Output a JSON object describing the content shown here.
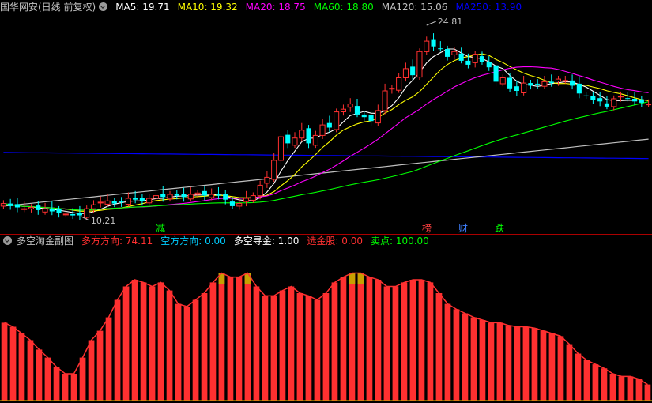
{
  "main_panel": {
    "title": "国华网安(日线 前复权)",
    "indicators": [
      {
        "label": "MA5: 19.71",
        "color": "#ffffff"
      },
      {
        "label": "MA10: 19.32",
        "color": "#ffff00"
      },
      {
        "label": "MA20: 18.75",
        "color": "#ff00ff"
      },
      {
        "label": "MA60: 18.80",
        "color": "#00ff00"
      },
      {
        "label": "MA120: 15.06",
        "color": "#c0c0c0"
      },
      {
        "label": "MA250: 13.90",
        "color": "#0000ff"
      }
    ],
    "high_label": "24.81",
    "low_label": "10.21",
    "markers": [
      {
        "text": "减",
        "color": "#00ff00"
      },
      {
        "text": "榜",
        "color": "#ff4040"
      },
      {
        "text": "财",
        "color": "#4080ff"
      },
      {
        "text": "跌",
        "color": "#00ff00"
      }
    ]
  },
  "sub_panel": {
    "title": "多空淘金副图",
    "fields": [
      {
        "label": "多方方向: 74.11",
        "color": "#ff3030"
      },
      {
        "label": "空方方向: 0.00",
        "color": "#00ccff"
      },
      {
        "label": "多空寻金: 1.00",
        "color": "#ffffff"
      },
      {
        "label": "选金股: 0.00",
        "color": "#ff3030"
      },
      {
        "label": "卖点: 100.00",
        "color": "#00ff00"
      }
    ]
  },
  "chart_data": {
    "type": "bar",
    "series": [
      {
        "name": "多方方向",
        "values": [
          58,
          55,
          50,
          45,
          38,
          32,
          25,
          20,
          20,
          32,
          45,
          52,
          62,
          75,
          85,
          90,
          88,
          85,
          88,
          82,
          72,
          70,
          75,
          80,
          88,
          95,
          92,
          92,
          95,
          85,
          78,
          78,
          82,
          85,
          80,
          78,
          75,
          80,
          88,
          92,
          95,
          95,
          92,
          90,
          85,
          85,
          88,
          90,
          90,
          88,
          80,
          72,
          68,
          65,
          62,
          60,
          58,
          58,
          56,
          55,
          55,
          54,
          52,
          50,
          48,
          42,
          35,
          30,
          27,
          24,
          20,
          18,
          18,
          16,
          12
        ]
      }
    ],
    "ylim": [
      0,
      100
    ]
  },
  "colors": {
    "up": "#ff3030",
    "down": "#00ffff",
    "separator": "#aa0000",
    "ref_line": "#00ff00",
    "gold": "#c8a000"
  }
}
